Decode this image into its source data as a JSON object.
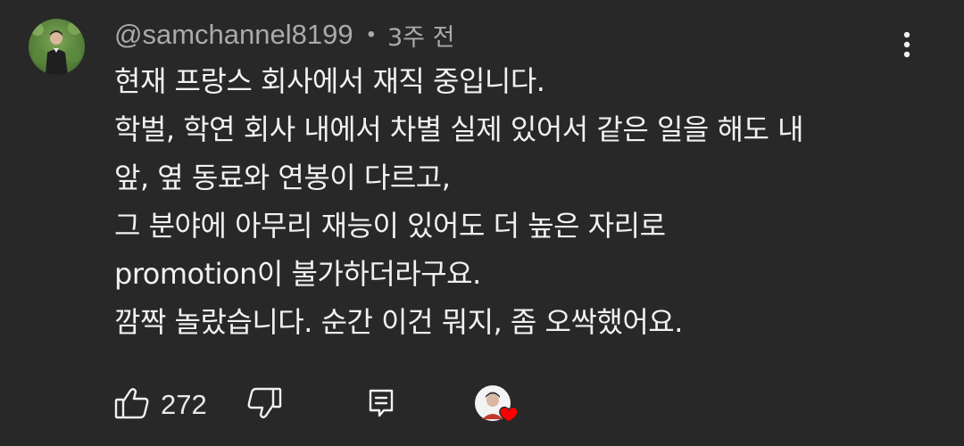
{
  "comment": {
    "author": "@samchannel8199",
    "separator": "•",
    "time": "3주 전",
    "lines": [
      "현재 프랑스 회사에서 재직 중입니다.",
      "학벌, 학연 회사 내에서 차별 실제 있어서 같은 일을 해도 내",
      "앞, 옆 동료와 연봉이 다르고,",
      "그 분야에 아무리 재능이 있어도 더 높은 자리로",
      "promotion이 불가하더라구요.",
      "깜짝 놀랐습니다. 순간 이건 뭐지, 좀 오싹했어요."
    ]
  },
  "actions": {
    "like_count": "272"
  },
  "icons": {
    "avatar": "user-avatar",
    "more": "more-vertical-icon",
    "like": "thumbs-up-icon",
    "dislike": "thumbs-down-icon",
    "reply": "reply-icon",
    "creator_heart": "creator-heart-icon"
  },
  "colors": {
    "background": "#282828",
    "text": "#f1f1f1",
    "secondary_text": "#aaaaaa",
    "heart": "#ff0000"
  }
}
